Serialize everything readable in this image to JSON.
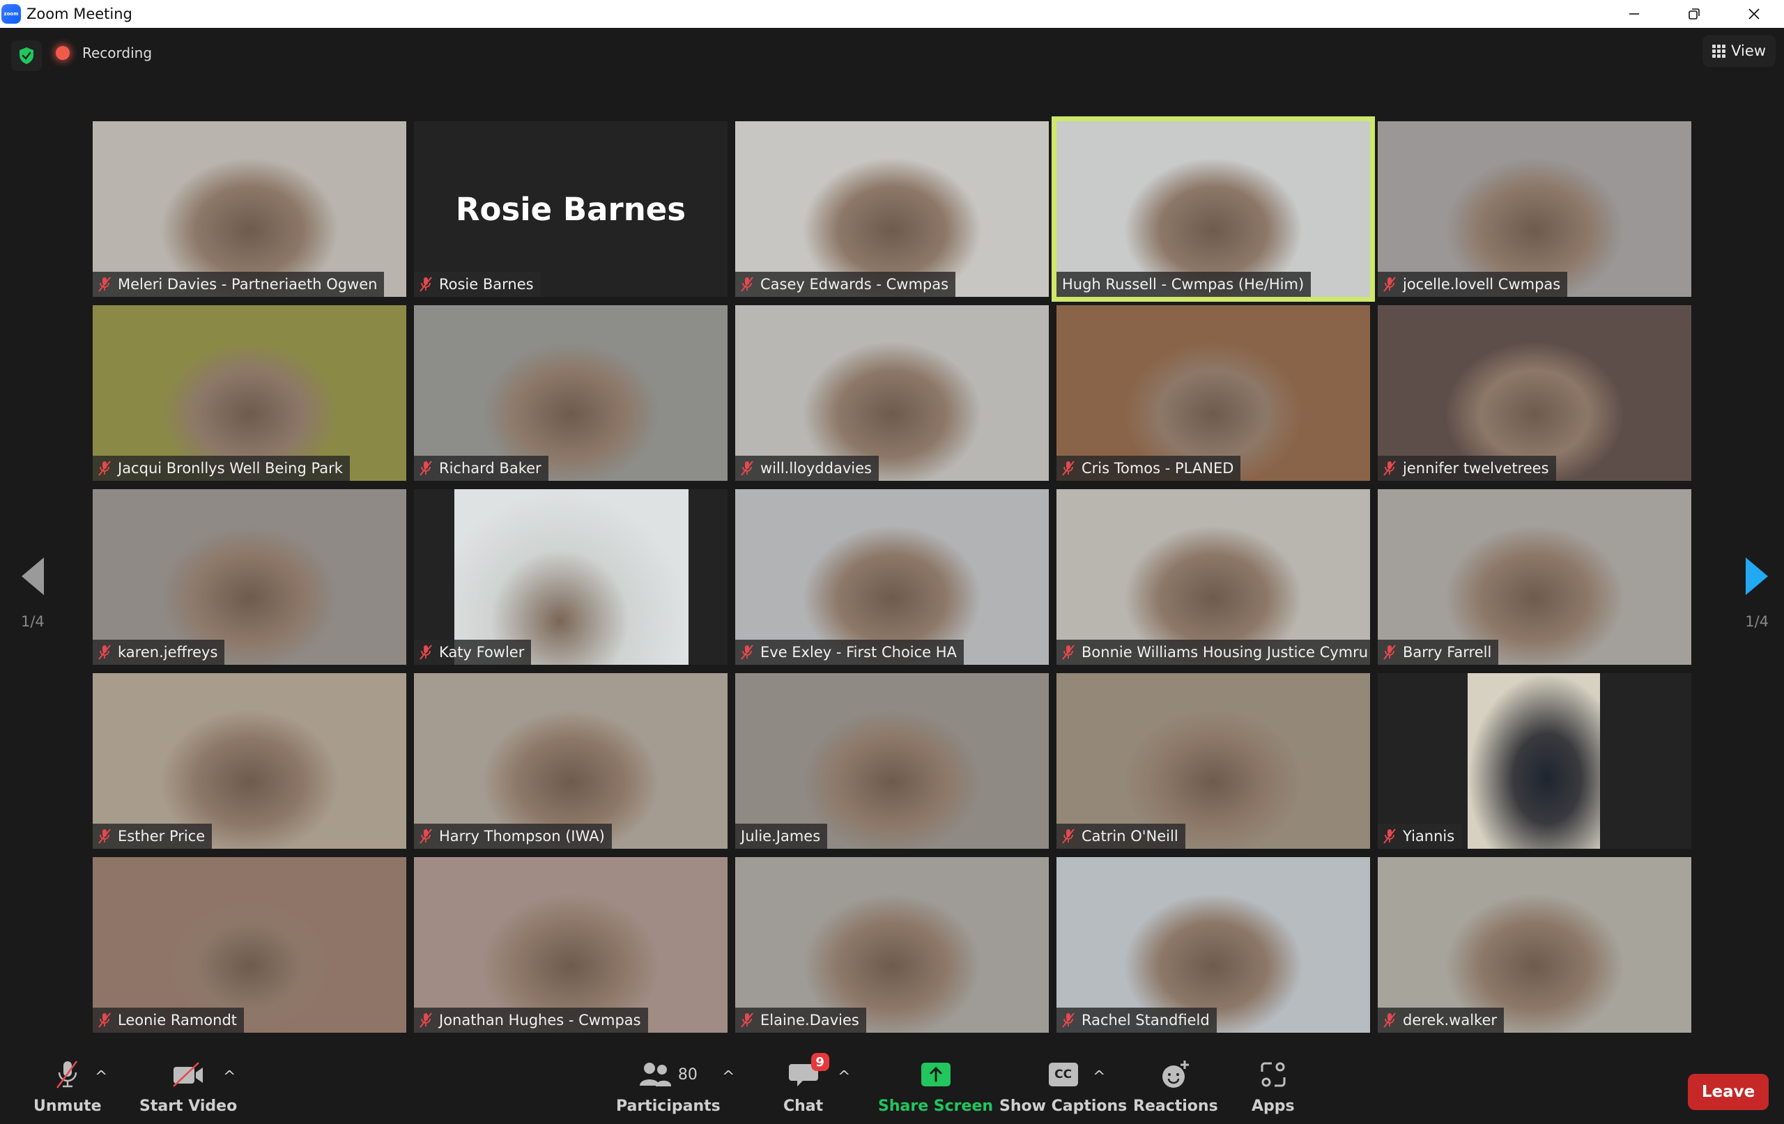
{
  "window": {
    "title": "Zoom Meeting",
    "controls": {
      "minimize_icon": "minimize-icon",
      "restore_icon": "restore-icon",
      "close_icon": "close-icon"
    }
  },
  "topbar": {
    "security_icon": "shield-check-icon",
    "recording_label": "Recording",
    "view_label": "View"
  },
  "pagination": {
    "current": "1/4",
    "prev_page_label": "1/4",
    "next_page_label": "1/4"
  },
  "colors": {
    "active_speaker_border": "#cde86a",
    "share_screen": "#22c55e",
    "leave": "#c62828",
    "muted_icon": "#e5484d",
    "next_arrow": "#23a8f2",
    "chat_badge": "#e5393d"
  },
  "participants": [
    {
      "name": "Meleri Davies - Partneriaeth Ogwen",
      "muted": true,
      "video": true,
      "bg": "#b9b5ae"
    },
    {
      "name": "Rosie Barnes",
      "muted": true,
      "video": false,
      "display_name": "Rosie Barnes"
    },
    {
      "name": "Casey Edwards - Cwmpas",
      "muted": true,
      "video": true,
      "bg": "#c8c6c2"
    },
    {
      "name": "Hugh Russell - Cwmpas (He/Him)",
      "muted": false,
      "video": true,
      "active_speaker": true,
      "bg": "#c9cbcb"
    },
    {
      "name": "jocelle.lovell Cwmpas",
      "muted": true,
      "video": true,
      "bg": "#9a9796"
    },
    {
      "name": "Jacqui Bronllys Well Being Park",
      "muted": true,
      "video": true,
      "bg": "#8a8a46"
    },
    {
      "name": "Richard Baker",
      "muted": true,
      "video": true,
      "bg": "#8d8e8a"
    },
    {
      "name": "will.lloyddavies",
      "muted": true,
      "video": true,
      "bg": "#b8b7b3"
    },
    {
      "name": "Cris Tomos - PLANED",
      "muted": true,
      "video": true,
      "bg": "#8a6448"
    },
    {
      "name": "jennifer twelvetrees",
      "muted": true,
      "video": true,
      "bg": "#5e4e4a"
    },
    {
      "name": "karen.jeffreys",
      "muted": true,
      "video": true,
      "bg": "#8f8a86"
    },
    {
      "name": "Katy Fowler",
      "muted": true,
      "video": true,
      "portrait": true,
      "bg": "#dfe2e2"
    },
    {
      "name": "Eve Exley - First Choice HA",
      "muted": true,
      "video": true,
      "bg": "#b2b3b5"
    },
    {
      "name": "Bonnie Williams Housing Justice Cymru",
      "muted": true,
      "video": true,
      "bg": "#b9b6b0"
    },
    {
      "name": "Barry Farrell",
      "muted": true,
      "video": true,
      "bg": "#a39f9a"
    },
    {
      "name": "Esther Price",
      "muted": true,
      "video": true,
      "bg": "#a89c8c"
    },
    {
      "name": "Harry Thompson (IWA)",
      "muted": true,
      "video": true,
      "bg": "#a59c91"
    },
    {
      "name": "Julie.James",
      "muted": false,
      "video": true,
      "bg": "#8f8a84"
    },
    {
      "name": "Catrin O'Neill",
      "muted": true,
      "video": true,
      "bg": "#948878"
    },
    {
      "name": "Yiannis",
      "muted": true,
      "video": true,
      "portrait_narrow": true,
      "bg": "#6d6455"
    },
    {
      "name": "Leonie Ramondt",
      "muted": true,
      "video": true,
      "bg": "#8f7468"
    },
    {
      "name": "Jonathan Hughes - Cwmpas",
      "muted": true,
      "video": true,
      "bg": "#a08c84"
    },
    {
      "name": "Elaine.Davies",
      "muted": true,
      "video": true,
      "bg": "#9f9c97"
    },
    {
      "name": "Rachel Standfield",
      "muted": true,
      "video": true,
      "bg": "#b7bcc0"
    },
    {
      "name": "derek.walker",
      "muted": true,
      "video": true,
      "bg": "#a7a49c"
    }
  ],
  "toolbar": {
    "unmute": {
      "label": "Unmute",
      "icon": "microphone-muted-icon"
    },
    "start_video": {
      "label": "Start Video",
      "icon": "camera-off-icon"
    },
    "participants": {
      "label": "Participants",
      "count": "80",
      "icon": "participants-icon"
    },
    "chat": {
      "label": "Chat",
      "badge": "9",
      "icon": "chat-icon"
    },
    "share_screen": {
      "label": "Share Screen",
      "icon": "share-screen-icon"
    },
    "captions": {
      "label": "Show Captions",
      "icon_text": "CC",
      "icon": "captions-icon"
    },
    "reactions": {
      "label": "Reactions",
      "icon": "reactions-icon"
    },
    "apps": {
      "label": "Apps",
      "icon": "apps-icon"
    },
    "leave": {
      "label": "Leave"
    },
    "caret_glyph": "^"
  }
}
